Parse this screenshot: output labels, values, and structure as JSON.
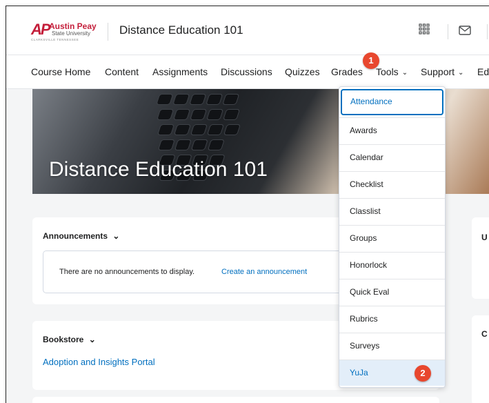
{
  "brand": {
    "logo_mark": "AP",
    "logo_name": "Austin Peay",
    "logo_sub": "State University",
    "logo_city": "CLARKSVILLE TENNESSEE",
    "color": "#c41e3a"
  },
  "header": {
    "course_title": "Distance Education 101",
    "icons": [
      "grid-icon",
      "mail-icon"
    ]
  },
  "nav": {
    "items": [
      {
        "label": "Course Home"
      },
      {
        "label": "Content"
      },
      {
        "label": "Assignments"
      },
      {
        "label": "Discussions"
      },
      {
        "label": "Quizzes"
      },
      {
        "label": "Grades"
      },
      {
        "label": "Tools",
        "has_dropdown": true
      },
      {
        "label": "Support",
        "has_dropdown": true
      },
      {
        "label": "Ed"
      }
    ]
  },
  "banner": {
    "title": "Distance Education 101"
  },
  "announcements": {
    "title": "Announcements",
    "empty_text": "There are no announcements to display.",
    "create_link": "Create an announcement"
  },
  "bookstore": {
    "title": "Bookstore",
    "link": "Adoption and Insights Portal"
  },
  "side_cards": {
    "first_label": "U",
    "second_label": "C"
  },
  "tools_menu": {
    "items": [
      {
        "label": "Attendance",
        "state": "focused"
      },
      {
        "label": "Awards"
      },
      {
        "label": "Calendar"
      },
      {
        "label": "Checklist"
      },
      {
        "label": "Classlist"
      },
      {
        "label": "Groups"
      },
      {
        "label": "Honorlock"
      },
      {
        "label": "Quick Eval"
      },
      {
        "label": "Rubrics"
      },
      {
        "label": "Surveys"
      },
      {
        "label": "YuJa",
        "state": "highlighted"
      }
    ]
  },
  "callouts": {
    "step1": "1",
    "step2": "2",
    "color": "#e8472e"
  },
  "colors": {
    "link": "#006fbf",
    "page_bg": "#f4f5f6"
  }
}
